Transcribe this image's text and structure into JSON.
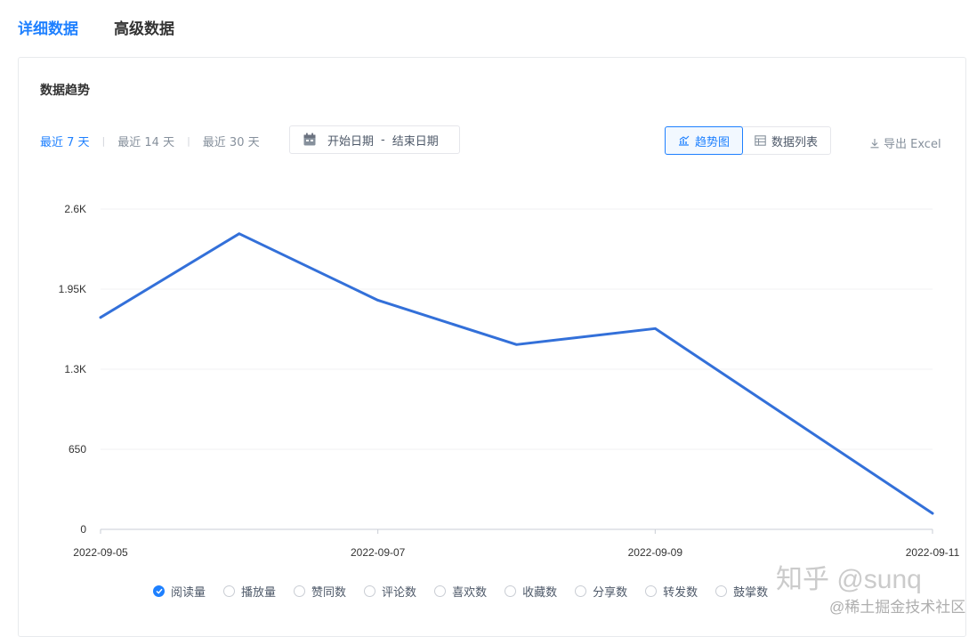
{
  "tabs": [
    {
      "label": "详细数据",
      "active": true
    },
    {
      "label": "高级数据",
      "active": false
    }
  ],
  "card": {
    "title": "数据趋势",
    "range_options": [
      {
        "label": "最近 7 天",
        "active": true
      },
      {
        "label": "最近 14 天",
        "active": false
      },
      {
        "label": "最近 30 天",
        "active": false
      }
    ],
    "date_picker": {
      "start": "开始日期",
      "separator": "-",
      "end": "结束日期"
    },
    "view_toggle": [
      {
        "label": "趋势图",
        "active": true
      },
      {
        "label": "数据列表",
        "active": false
      }
    ],
    "export_label": "导出 Excel"
  },
  "chart_data": {
    "type": "line",
    "x": [
      "2022-09-05",
      "2022-09-06",
      "2022-09-07",
      "2022-09-08",
      "2022-09-09",
      "2022-09-10",
      "2022-09-11"
    ],
    "x_tick_labels": [
      "2022-09-05",
      "2022-09-07",
      "2022-09-09",
      "2022-09-11"
    ],
    "y_tick_labels": [
      "0",
      "650",
      "1.3K",
      "1.95K",
      "2.6K"
    ],
    "ylim": [
      0,
      2600
    ],
    "series": [
      {
        "name": "阅读量",
        "values": [
          1720,
          2400,
          1860,
          1500,
          1630,
          880,
          130
        ],
        "color": "#3370d9"
      }
    ],
    "grid": true
  },
  "legend": [
    {
      "label": "阅读量",
      "checked": true
    },
    {
      "label": "播放量",
      "checked": false
    },
    {
      "label": "赞同数",
      "checked": false
    },
    {
      "label": "评论数",
      "checked": false
    },
    {
      "label": "喜欢数",
      "checked": false
    },
    {
      "label": "收藏数",
      "checked": false
    },
    {
      "label": "分享数",
      "checked": false
    },
    {
      "label": "转发数",
      "checked": false
    },
    {
      "label": "鼓掌数",
      "checked": false
    }
  ],
  "watermarks": [
    "知乎 @sunq",
    "@稀土掘金技术社区"
  ]
}
